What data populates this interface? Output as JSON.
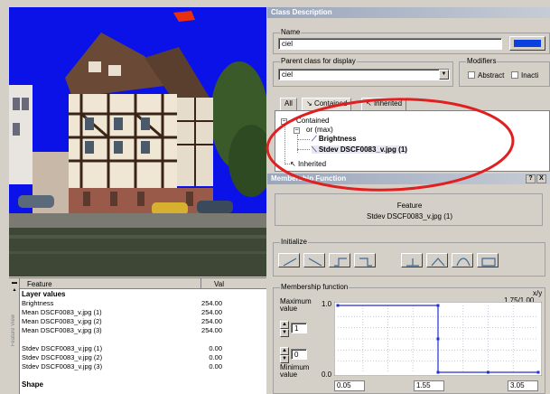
{
  "class_description": {
    "title": "Class Description",
    "name_label": "Name",
    "name_value": "ciel",
    "parent_label": "Parent class for display",
    "parent_value": "ciel",
    "modifiers_label": "Modifiers",
    "abstract_label": "Abstract",
    "inactive_label": "Inacti",
    "class_color": "#0a40e0",
    "tabs": [
      "All",
      "Contained",
      "Inherited"
    ],
    "tree": {
      "contained": "Contained",
      "or_max": "or (max)",
      "item_1": "Brightness",
      "item_2": "Stdev DSCF0083_v.jpg (1)",
      "inherited": "Inherited"
    }
  },
  "membership_function": {
    "title": "Membership Function",
    "help_button": "?",
    "close_button": "X",
    "feature_label": "Feature",
    "feature_value": "Stdev DSCF0083_v.jpg (1)",
    "initialize_label": "Initialize",
    "function_label": "Membership function",
    "max_label": "Maximum value",
    "min_label": "Minimum value",
    "max_input": "1",
    "min_input": "0",
    "xy_label": "x/y",
    "xy_value": "1.75/1.00",
    "y_top": "1.0",
    "y_bottom": "0.0",
    "x_left": "0.05",
    "x_mid": "1.55",
    "x_right": "3.05"
  },
  "feature_table": {
    "col_feature": "Feature",
    "col_value": "Val",
    "side_label": "Feature View",
    "rows": [
      {
        "label": "Layer values",
        "value": "",
        "group": true
      },
      {
        "label": "Brightness",
        "value": "254.00"
      },
      {
        "label": "Mean DSCF0083_v.jpg (1)",
        "value": "254.00"
      },
      {
        "label": "Mean DSCF0083_v.jpg (2)",
        "value": "254.00"
      },
      {
        "label": "Mean DSCF0083_v.jpg (3)",
        "value": "254.00"
      },
      {
        "label": "",
        "value": ""
      },
      {
        "label": "Stdev DSCF0083_v.jpg (1)",
        "value": "0.00"
      },
      {
        "label": "Stdev DSCF0083_v.jpg (2)",
        "value": "0.00"
      },
      {
        "label": "Stdev DSCF0083_v.jpg (3)",
        "value": "0.00"
      },
      {
        "label": "",
        "value": ""
      },
      {
        "label": "Shape",
        "value": "",
        "group": true
      }
    ]
  },
  "chart_data": {
    "type": "line",
    "x_range": [
      0.05,
      3.05
    ],
    "y_range": [
      0,
      1
    ],
    "points": [
      [
        0.05,
        1.0
      ],
      [
        1.55,
        1.0
      ],
      [
        1.55,
        0.5
      ],
      [
        1.55,
        0.0
      ],
      [
        2.3,
        0.0
      ],
      [
        3.05,
        0.0
      ]
    ]
  },
  "colors": {
    "annotation": "#e02020",
    "sky": "#0a12e8",
    "line": "#2030d0"
  }
}
